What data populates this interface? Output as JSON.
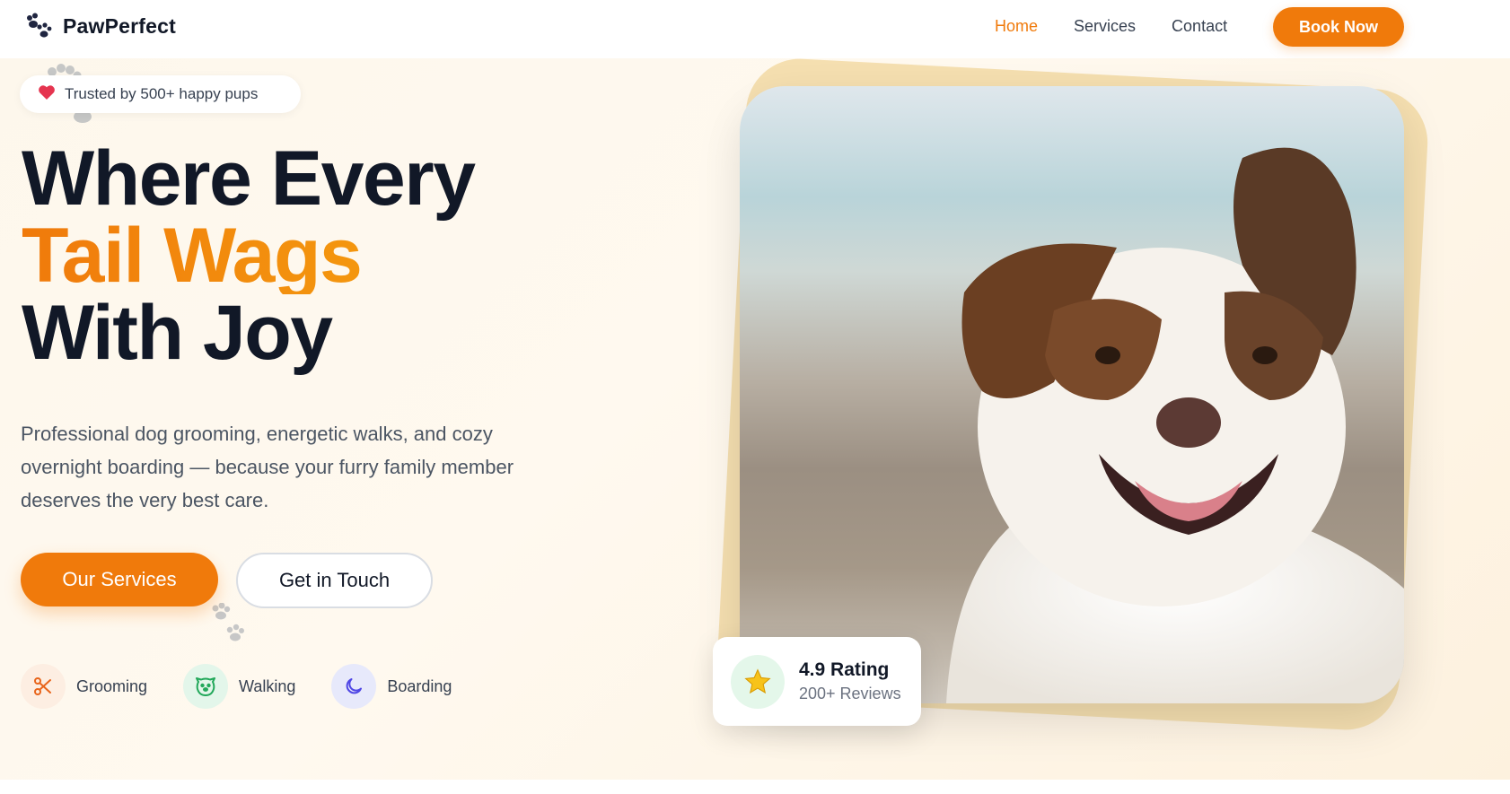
{
  "brand": {
    "name": "PawPerfect",
    "icon": "paw-icon"
  },
  "nav": {
    "items": [
      {
        "label": "Home",
        "active": true
      },
      {
        "label": "Services",
        "active": false
      },
      {
        "label": "Contact",
        "active": false
      }
    ],
    "cta_label": "Book Now"
  },
  "hero": {
    "badge": {
      "icon": "heart-icon",
      "text": "Trusted by 500+ happy pups"
    },
    "title_line_1": "Where Every",
    "title_line_2": "Tail Wags",
    "title_line_3": "With Joy",
    "description": "Professional dog grooming, energetic walks, and cozy overnight boarding — because your furry family member deserves the very best care.",
    "primary_button": "Our Services",
    "secondary_button": "Get in Touch",
    "features": [
      {
        "label": "Grooming",
        "icon": "scissors-icon",
        "bg": "#fdeee2",
        "color": "#e8641a"
      },
      {
        "label": "Walking",
        "icon": "dog-face-icon",
        "bg": "#e3f6ea",
        "color": "#22a85a"
      },
      {
        "label": "Boarding",
        "icon": "moon-icon",
        "bg": "#e7e9fb",
        "color": "#4f46e5"
      }
    ]
  },
  "rating_card": {
    "icon": "star-icon",
    "value": "4.9 Rating",
    "reviews": "200+ Reviews"
  },
  "colors": {
    "accent": "#f07a0b",
    "accent_light": "#f5a010",
    "text_dark": "#111827",
    "text_muted": "#4b5563"
  }
}
